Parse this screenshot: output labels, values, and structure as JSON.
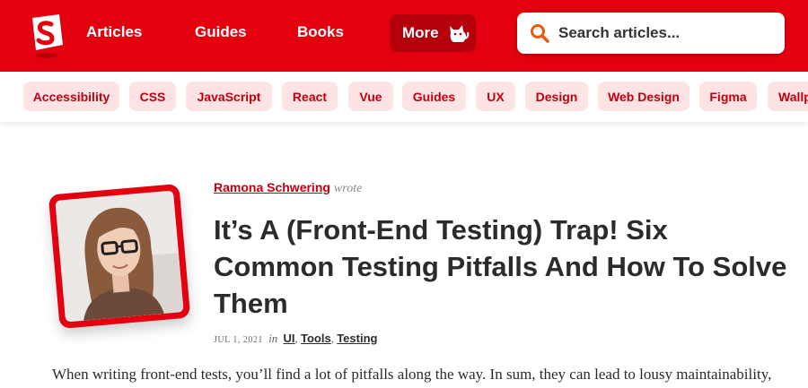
{
  "nav": {
    "articles": "Articles",
    "guides": "Guides",
    "books": "Books",
    "more": "More"
  },
  "search": {
    "placeholder": "Search articles..."
  },
  "tags": [
    "Accessibility",
    "CSS",
    "JavaScript",
    "React",
    "Vue",
    "Guides",
    "UX",
    "Design",
    "Web Design",
    "Figma",
    "Wallp"
  ],
  "article": {
    "author": "Ramona Schwering",
    "author_verb": "wrote",
    "title": "It’s A (Front-End Testing) Trap! Six Common Testing Pitfalls And How To Solve Them",
    "date": "JUL 1, 2021",
    "in_word": "in",
    "categories": [
      "UI",
      "Tools",
      "Testing"
    ],
    "intro": "When writing front-end tests, you’ll find a lot of pitfalls along the way. In sum, they can lead to lousy maintainability,"
  },
  "colors": {
    "brand_red": "#e3000f",
    "tag_bg": "#fde3e4",
    "tag_text": "#c1000e"
  },
  "icons": {
    "logo": "smashing-logo-icon",
    "search": "search-icon",
    "more": "cat-icon"
  }
}
